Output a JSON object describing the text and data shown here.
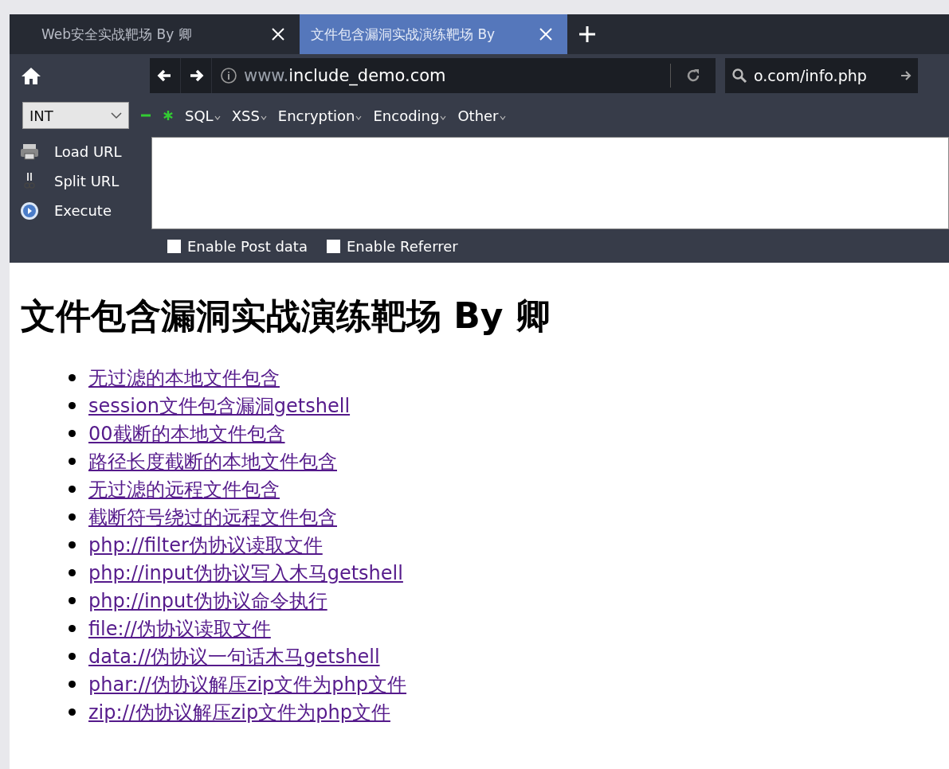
{
  "tabs": [
    {
      "label": "Web安全实战靶场 By 卿",
      "selected": false
    },
    {
      "label": "文件包含漏洞实战演练靶场 By",
      "selected": true
    }
  ],
  "address_bar": {
    "prefix": "www.",
    "host": "include_demo.com"
  },
  "search_field": {
    "value": "o.com/info.php"
  },
  "hackbar": {
    "select": "INT",
    "menus": [
      "SQL",
      "XSS",
      "Encryption",
      "Encoding",
      "Other"
    ],
    "actions": [
      {
        "kind": "load",
        "label": "Load URL"
      },
      {
        "kind": "split",
        "label": "Split URL"
      },
      {
        "kind": "execute",
        "label": "Execute"
      }
    ],
    "options": [
      {
        "label": "Enable Post data",
        "checked": false
      },
      {
        "label": "Enable Referrer",
        "checked": false
      }
    ]
  },
  "page": {
    "heading": "文件包含漏洞实战演练靶场 By 卿",
    "links": [
      "无过滤的本地文件包含",
      "session文件包含漏洞getshell",
      "00截断的本地文件包含",
      "路径长度截断的本地文件包含",
      "无过滤的远程文件包含",
      "截断符号绕过的远程文件包含",
      "php://filter伪协议读取文件",
      "php://input伪协议写入木马getshell",
      "php://input伪协议命令执行",
      "file://伪协议读取文件",
      "data://伪协议一句话木马getshell",
      "phar://伪协议解压zip文件为php文件",
      "zip://伪协议解压zip文件为php文件"
    ]
  }
}
